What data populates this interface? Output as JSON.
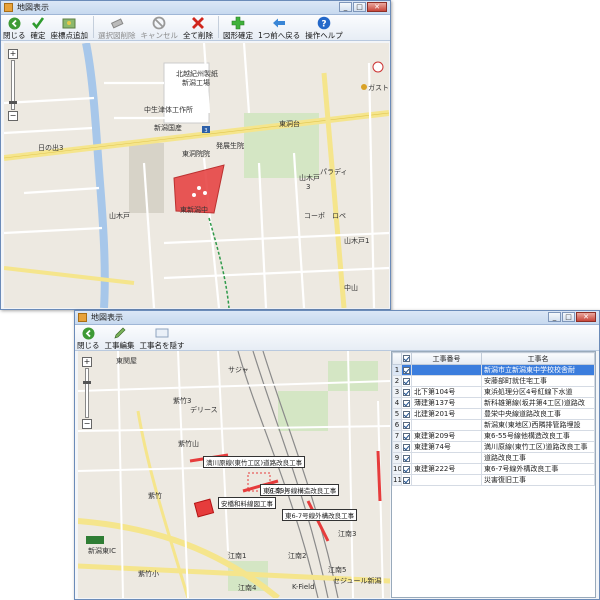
{
  "window1": {
    "title": "地図表示",
    "toolbar": [
      {
        "label": "閉じる",
        "icon": "close-circle-icon",
        "disabled": false
      },
      {
        "label": "確定",
        "icon": "checkmark-icon",
        "disabled": false
      },
      {
        "label": "座標点追加",
        "icon": "add-point-icon",
        "disabled": false
      },
      {
        "label": "選択図削除",
        "icon": "eraser-icon",
        "disabled": true
      },
      {
        "label": "キャンセル",
        "icon": "cancel-icon",
        "disabled": true
      },
      {
        "label": "全て削除",
        "icon": "delete-all-icon",
        "disabled": false
      },
      {
        "label": "図形確定",
        "icon": "green-plus-icon",
        "disabled": false
      },
      {
        "label": "1つ前へ戻る",
        "icon": "back-arrow-icon",
        "disabled": false
      },
      {
        "label": "操作ヘルプ",
        "icon": "help-icon",
        "disabled": false
      }
    ],
    "map_labels": {
      "l1": "北越紀州製紙",
      "l2": "新潟工場",
      "l3": "中生津体工作所",
      "l4": "新潟国産",
      "l5": "東洞院院",
      "l6": "東洞台",
      "l7": "発展生院",
      "l8": "山木戸",
      "l9": "3",
      "l10": "東新潟中",
      "l11": "ガスト",
      "l12": "山木戸",
      "l13": "パラディ",
      "l14": "コーポ",
      "l15": "ロペ",
      "l16": "山木戸1",
      "l17": "中山",
      "l18": "日の出3"
    }
  },
  "window2": {
    "title": "地図表示",
    "toolbar": [
      {
        "label": "閉じる",
        "icon": "close-circle-icon",
        "disabled": false
      },
      {
        "label": "工事編集",
        "icon": "pencil-icon",
        "disabled": false
      },
      {
        "label": "工事名を隠す",
        "icon": "hide-label-icon",
        "disabled": false
      }
    ],
    "grid": {
      "header_name": "工事番号",
      "header_title": "工事名",
      "rows": [
        {
          "no": "1",
          "id": "",
          "name": "新潟市立新潟東中学校校舎耐",
          "selected": true
        },
        {
          "no": "2",
          "id": "",
          "name": "安藤部町就住宅工事",
          "selected": false
        },
        {
          "no": "3",
          "id": "北下第104号",
          "name": "東浜処理分区4号紅線下水道",
          "selected": false
        },
        {
          "no": "4",
          "id": "薄建第137号",
          "name": "新科雄第線(坂井第4工区)道路改",
          "selected": false
        },
        {
          "no": "5",
          "id": "北建第201号",
          "name": "豊栄中央線道路改良工事",
          "selected": false
        },
        {
          "no": "6",
          "id": "",
          "name": "新潟東(東地区)西隣排管路埋設",
          "selected": false
        },
        {
          "no": "7",
          "id": "東建第209号",
          "name": "東6-55号線他構造改良工事",
          "selected": false
        },
        {
          "no": "8",
          "id": "東建第74号",
          "name": "満川原線(東竹工区)道路改良工事",
          "selected": false
        },
        {
          "no": "9",
          "id": "",
          "name": "道路改良工事",
          "selected": false
        },
        {
          "no": "10",
          "id": "東建第222号",
          "name": "東6-7号線外構改良工事",
          "selected": false
        },
        {
          "no": "11",
          "id": "",
          "name": "災害復旧工事",
          "selected": false
        }
      ]
    },
    "callouts": {
      "c1": "満川原線(東竹工区)道路改良工事",
      "c2": "安橋和料線図工事",
      "c3": "東6-7号線外構改良工事",
      "c4": "東6-55号線構造改良工事"
    },
    "map_labels": {
      "m1": "江南小",
      "m2": "東関屋",
      "m3": "紫竹3",
      "m4": "紫竹山",
      "m5": "江南1",
      "m6": "デリース",
      "m7": "江南2",
      "m8": "江南3",
      "m9": "紫竹",
      "m10": "新潟東IC",
      "m11": "サジャ",
      "m12": "江南5",
      "m13": "セジュール新潟",
      "m14": "K-Field",
      "m15": "紫竹小",
      "m16": "江南4"
    }
  }
}
